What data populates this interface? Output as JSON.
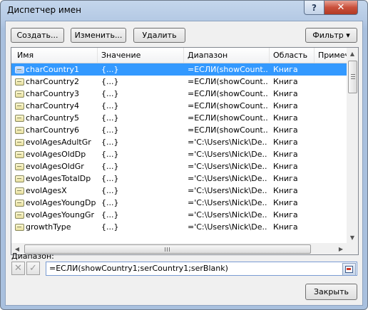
{
  "window": {
    "title": "Диспетчер имен",
    "help_label": "?",
    "close_label": "✕"
  },
  "toolbar": {
    "create_label": "Создать...",
    "edit_label": "Изменить...",
    "delete_label": "Удалить",
    "filter_label": "Фильтр ▾"
  },
  "table": {
    "columns": [
      "Имя",
      "Значение",
      "Диапазон",
      "Область",
      "Примеча"
    ],
    "rows": [
      {
        "name": "charCountry1",
        "value": "{...}",
        "range": "=ЕСЛИ(showCount...",
        "scope": "Книга",
        "selected": true
      },
      {
        "name": "charCountry2",
        "value": "{...}",
        "range": "=ЕСЛИ(showCount...",
        "scope": "Книга"
      },
      {
        "name": "charCountry3",
        "value": "{...}",
        "range": "=ЕСЛИ(showCount...",
        "scope": "Книга"
      },
      {
        "name": "charCountry4",
        "value": "{...}",
        "range": "=ЕСЛИ(showCount...",
        "scope": "Книга"
      },
      {
        "name": "charCountry5",
        "value": "{...}",
        "range": "=ЕСЛИ(showCount...",
        "scope": "Книга"
      },
      {
        "name": "charCountry6",
        "value": "{...}",
        "range": "=ЕСЛИ(showCount...",
        "scope": "Книга"
      },
      {
        "name": "evolAgesAdultGr",
        "value": "{...}",
        "range": "='C:\\Users\\Nick\\De...",
        "scope": "Книга"
      },
      {
        "name": "evolAgesOldDp",
        "value": "{...}",
        "range": "='C:\\Users\\Nick\\De...",
        "scope": "Книга"
      },
      {
        "name": "evolAgesOldGr",
        "value": "{...}",
        "range": "='C:\\Users\\Nick\\De...",
        "scope": "Книга"
      },
      {
        "name": "evolAgesTotalDp",
        "value": "{...}",
        "range": "='C:\\Users\\Nick\\De...",
        "scope": "Книга"
      },
      {
        "name": "evolAgesX",
        "value": "{...}",
        "range": "='C:\\Users\\Nick\\De...",
        "scope": "Книга"
      },
      {
        "name": "evolAgesYoungDp",
        "value": "{...}",
        "range": "='C:\\Users\\Nick\\De...",
        "scope": "Книга"
      },
      {
        "name": "evolAgesYoungGr",
        "value": "{...}",
        "range": "='C:\\Users\\Nick\\De...",
        "scope": "Книга"
      },
      {
        "name": "growthType",
        "value": "{...}",
        "range": "='C:\\Users\\Nick\\De...",
        "scope": "Книга"
      }
    ]
  },
  "range_section": {
    "label": "Диапазон:",
    "cancel_icon": "✕",
    "confirm_icon": "✓",
    "formula_value": "=ЕСЛИ(showCountry1;serCountry1;serBlank)"
  },
  "footer": {
    "close_label": "Закрыть"
  },
  "colors": {
    "selection": "#3399ff",
    "frame": "#b4c9e4"
  }
}
